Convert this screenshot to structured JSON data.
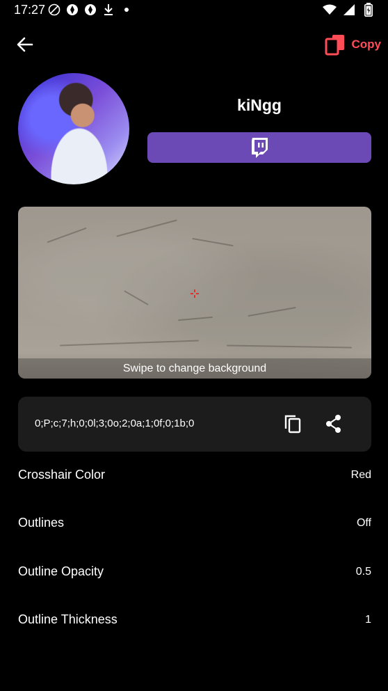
{
  "status_bar": {
    "time": "17:27"
  },
  "header": {
    "copy_label": "Copy"
  },
  "profile": {
    "username": "kiNgg"
  },
  "preview": {
    "caption": "Swipe to change background"
  },
  "crosshair_code": "0;P;c;7;h;0;0l;3;0o;2;0a;1;0f;0;1b;0",
  "settings": [
    {
      "label": "Crosshair Color",
      "value": "Red"
    },
    {
      "label": "Outlines",
      "value": "Off"
    },
    {
      "label": "Outline Opacity",
      "value": "0.5"
    },
    {
      "label": "Outline Thickness",
      "value": "1"
    }
  ],
  "colors": {
    "accent": "#ff4d57",
    "twitch": "#6c4ab6",
    "card": "#1c1c1c",
    "crosshair": "#e0312c"
  }
}
